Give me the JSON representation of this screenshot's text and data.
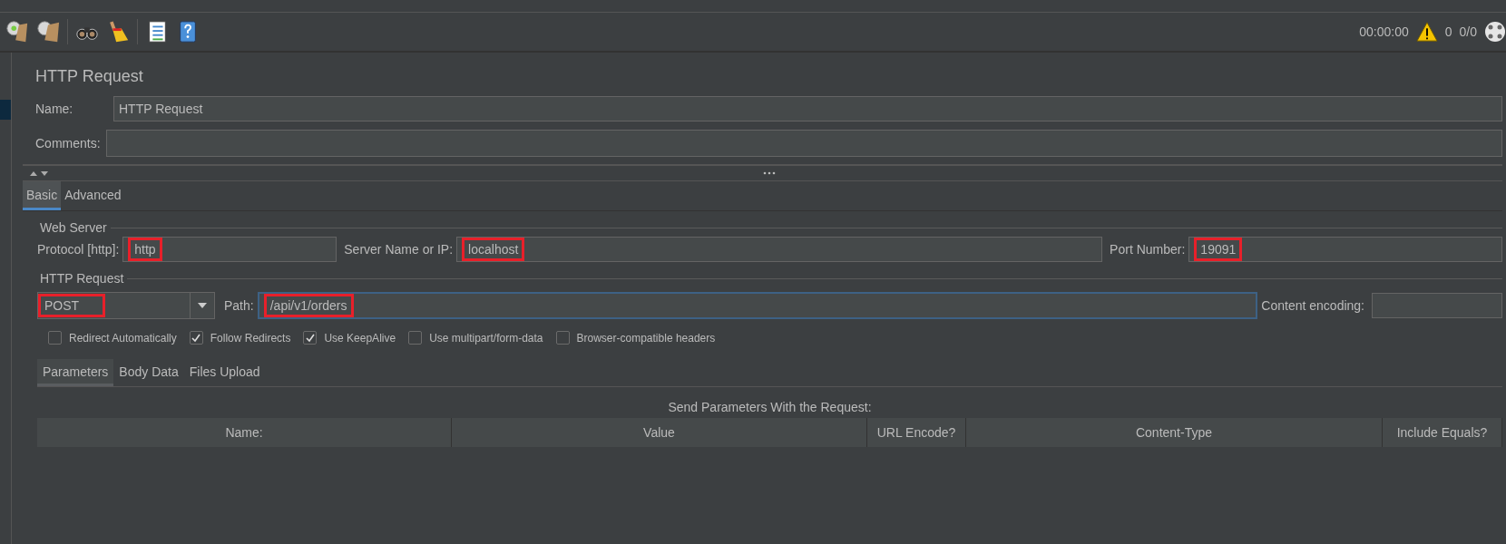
{
  "toolbar": {
    "timer": "00:00:00",
    "warning_count": "0",
    "threads": "0/0"
  },
  "title": "HTTP Request",
  "name_field": {
    "label": "Name:",
    "value": "HTTP Request"
  },
  "comments_field": {
    "label": "Comments:"
  },
  "tabs": [
    {
      "label": "Basic",
      "selected": true
    },
    {
      "label": "Advanced",
      "selected": false
    }
  ],
  "web_server": {
    "legend": "Web Server",
    "fields": [
      {
        "label": "Protocol [http]:",
        "value": "http",
        "highlighted": true
      },
      {
        "label": "Server Name or IP:",
        "value": "localhost",
        "highlighted": true
      },
      {
        "label": "Port Number:",
        "value": "19091",
        "highlighted": true
      }
    ]
  },
  "http_request": {
    "legend": "HTTP Request",
    "method": {
      "value": "POST",
      "highlighted": true
    },
    "path": {
      "label": "Path:",
      "value": "/api/v1/orders",
      "highlighted": true,
      "focused": true
    },
    "content_encoding": {
      "label": "Content encoding:"
    }
  },
  "options": [
    {
      "label": "Redirect Automatically",
      "checked": false
    },
    {
      "label": "Follow Redirects",
      "checked": true
    },
    {
      "label": "Use KeepAlive",
      "checked": true
    },
    {
      "label": "Use multipart/form-data",
      "checked": false
    },
    {
      "label": "Browser-compatible headers",
      "checked": false
    }
  ],
  "sub_tabs": [
    {
      "label": "Parameters",
      "selected": true
    },
    {
      "label": "Body Data",
      "selected": false
    },
    {
      "label": "Files Upload",
      "selected": false
    }
  ],
  "parameters": {
    "caption": "Send Parameters With the Request:",
    "columns": [
      "Name:",
      "Value",
      "URL Encode?",
      "Content-Type",
      "Include Equals?"
    ]
  }
}
